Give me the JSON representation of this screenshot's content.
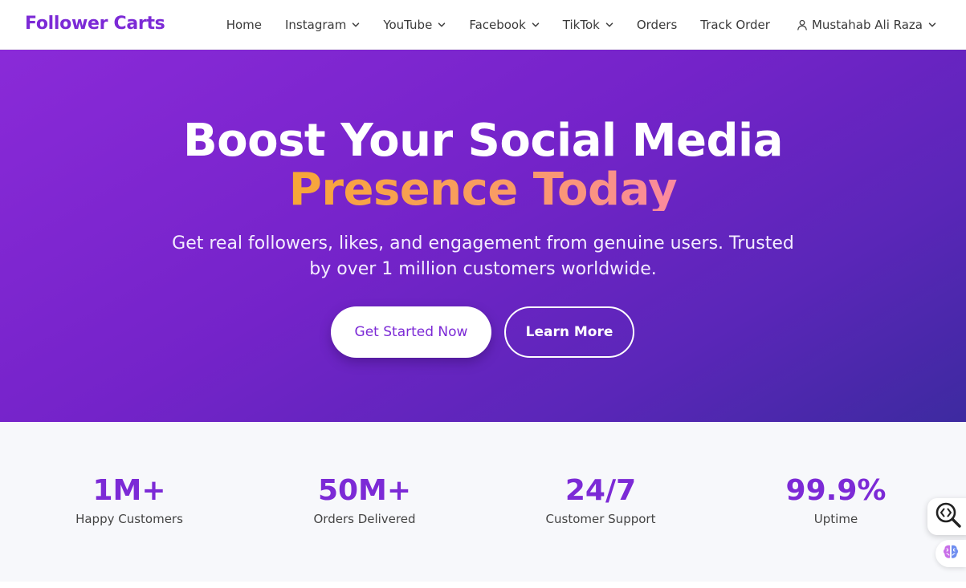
{
  "brand": {
    "name": "Follower Carts"
  },
  "nav": {
    "items": [
      {
        "label": "Home",
        "dropdown": false
      },
      {
        "label": "Instagram",
        "dropdown": true
      },
      {
        "label": "YouTube",
        "dropdown": true
      },
      {
        "label": "Facebook",
        "dropdown": true
      },
      {
        "label": "TikTok",
        "dropdown": true
      },
      {
        "label": "Orders",
        "dropdown": false
      },
      {
        "label": "Track Order",
        "dropdown": false
      }
    ],
    "user": {
      "name": "Mustahab Ali Raza",
      "icon": "user-icon"
    }
  },
  "hero": {
    "title_line1": "Boost Your Social Media",
    "title_line2": "Presence Today",
    "subtitle": "Get real followers, likes, and engagement from genuine users. Trusted by over 1 million customers worldwide.",
    "primary_button": "Get Started Now",
    "secondary_button": "Learn More"
  },
  "stats": [
    {
      "value": "1M+",
      "label": "Happy Customers"
    },
    {
      "value": "50M+",
      "label": "Orders Delivered"
    },
    {
      "value": "24/7",
      "label": "Customer Support"
    },
    {
      "value": "99.9%",
      "label": "Uptime"
    }
  ],
  "colors": {
    "brand": "#7c2ad6",
    "hero_gradient_start": "#8a2ad8",
    "hero_gradient_end": "#3d2aa0",
    "accent_gradient_start": "#f7a637",
    "accent_gradient_end": "#fb8aa0",
    "stats_background": "#f7f8fb"
  },
  "widgets": {
    "search_icon": "code-search-icon",
    "brain_icon": "brain-icon"
  }
}
